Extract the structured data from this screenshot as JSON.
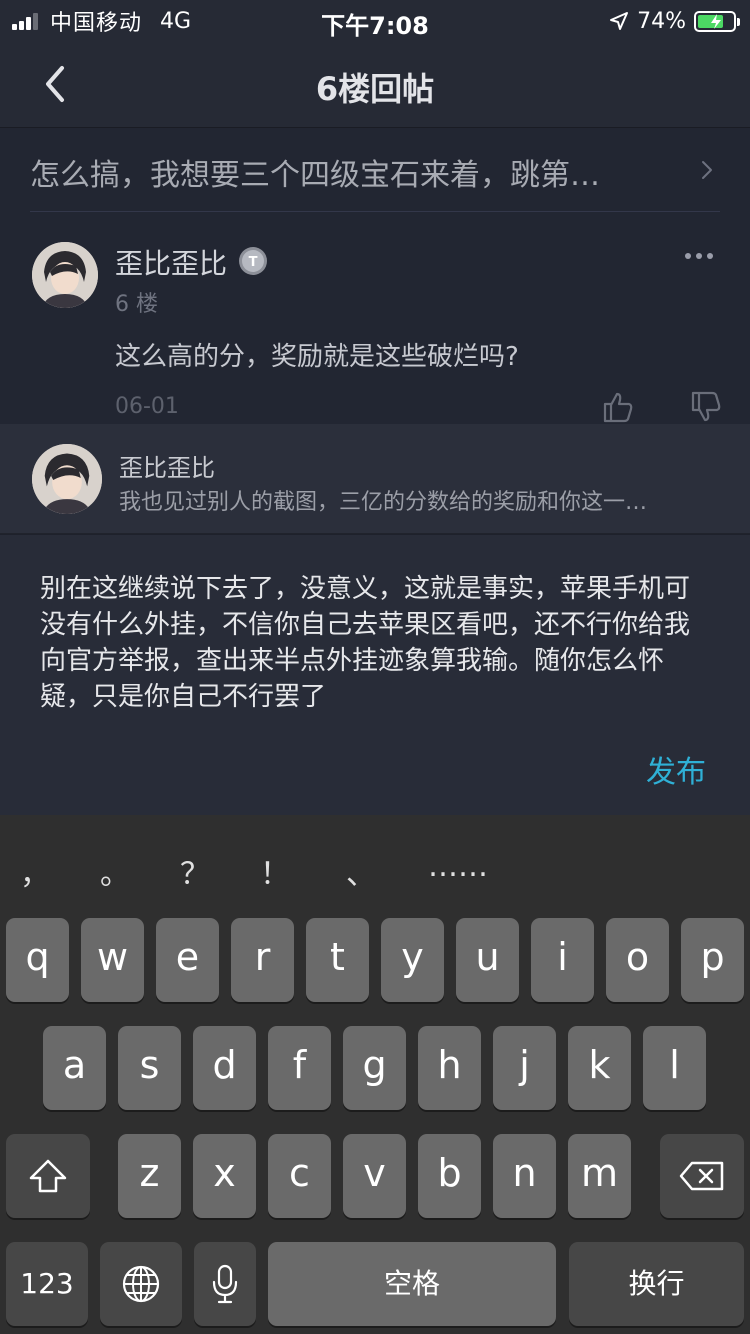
{
  "status_bar": {
    "carrier": "中国移动",
    "network": "4G",
    "time": "下午7:08",
    "battery_percent": "74%",
    "battery_level": 0.74
  },
  "nav": {
    "title": "6楼回帖",
    "back_icon": "chevron-left-icon"
  },
  "thread": {
    "title": "怎么搞，我想要三个四级宝石来着，跳第…"
  },
  "post": {
    "author": "歪比歪比",
    "floor": "6 楼",
    "content": "这么高的分，奖励就是这些破烂吗?",
    "date": "06-01"
  },
  "reply_preview": {
    "author": "歪比歪比",
    "text": "我也见过别人的截图，三亿的分数给的奖励和你这一…"
  },
  "composer": {
    "text": "别在这继续说下去了，没意义，这就是事实，苹果手机可没有什么外挂，不信你自己去苹果区看吧，还不行你给我向官方举报，查出来半点外挂迹象算我输。随你怎么怀疑，只是你自己不行罢了",
    "publish_label": "发布"
  },
  "keyboard": {
    "punctuation": [
      "，",
      "。",
      "？",
      "！",
      "、",
      "……"
    ],
    "row1": [
      "q",
      "w",
      "e",
      "r",
      "t",
      "y",
      "u",
      "i",
      "o",
      "p"
    ],
    "row2": [
      "a",
      "s",
      "d",
      "f",
      "g",
      "h",
      "j",
      "k",
      "l"
    ],
    "row3": [
      "z",
      "x",
      "c",
      "v",
      "b",
      "n",
      "m"
    ],
    "numbers_label": "123",
    "space_label": "空格",
    "return_label": "换行"
  },
  "colors": {
    "accent": "#2fb0d6",
    "background": "#1e212b",
    "battery_fill": "#4cd964"
  }
}
